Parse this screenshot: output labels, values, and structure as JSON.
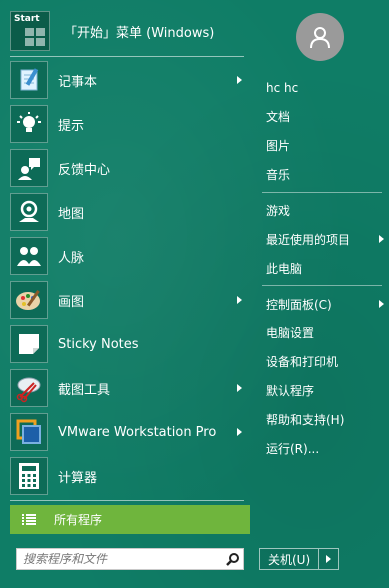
{
  "header": {
    "logo_text": "Start",
    "title": "「开始」菜单 (Windows)"
  },
  "programs": [
    {
      "label": "记事本",
      "icon": "notepad-icon",
      "has_submenu": true
    },
    {
      "label": "提示",
      "icon": "tips-icon",
      "has_submenu": false
    },
    {
      "label": "反馈中心",
      "icon": "feedback-icon",
      "has_submenu": false
    },
    {
      "label": "地图",
      "icon": "maps-icon",
      "has_submenu": false
    },
    {
      "label": "人脉",
      "icon": "people-icon",
      "has_submenu": false
    },
    {
      "label": "画图",
      "icon": "paint-icon",
      "has_submenu": true
    },
    {
      "label": "Sticky Notes",
      "icon": "sticky-notes-icon",
      "has_submenu": false
    },
    {
      "label": "截图工具",
      "icon": "snipping-tool-icon",
      "has_submenu": true
    },
    {
      "label": "VMware Workstation Pro",
      "icon": "vmware-icon",
      "has_submenu": true
    },
    {
      "label": "计算器",
      "icon": "calculator-icon",
      "has_submenu": false
    }
  ],
  "all_programs": {
    "label": "所有程序"
  },
  "search": {
    "placeholder": "搜索程序和文件"
  },
  "right": {
    "user": "hc hc",
    "group1": [
      {
        "label": "文档",
        "has_submenu": false
      },
      {
        "label": "图片",
        "has_submenu": false
      },
      {
        "label": "音乐",
        "has_submenu": false
      }
    ],
    "group2": [
      {
        "label": "游戏",
        "has_submenu": false
      },
      {
        "label": "最近使用的项目",
        "has_submenu": true
      },
      {
        "label": "此电脑",
        "has_submenu": false
      }
    ],
    "group3": [
      {
        "label": "控制面板(C)",
        "has_submenu": true
      },
      {
        "label": "电脑设置",
        "has_submenu": false
      },
      {
        "label": "设备和打印机",
        "has_submenu": false
      },
      {
        "label": "默认程序",
        "has_submenu": false
      },
      {
        "label": "帮助和支持(H)",
        "has_submenu": false
      },
      {
        "label": "运行(R)...",
        "has_submenu": false
      }
    ]
  },
  "power": {
    "label": "关机(U)"
  },
  "colors": {
    "background": "#0f7d66",
    "all_programs_bg": "#6fb53d",
    "avatar_bg": "#9a9a9a"
  }
}
